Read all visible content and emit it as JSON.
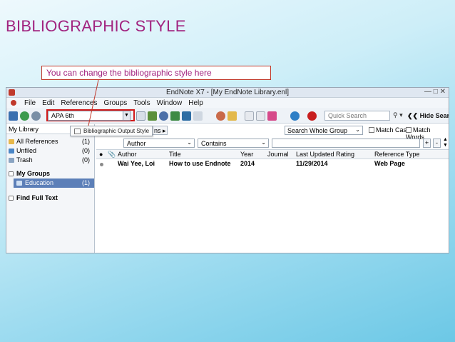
{
  "slide": {
    "title": "BIBLIOGRAPHIC STYLE",
    "callout": "You can change the bibliographic style here"
  },
  "window": {
    "title": "EndNote X7 - [My EndNote Library.enl]"
  },
  "menu": [
    "File",
    "Edit",
    "References",
    "Groups",
    "Tools",
    "Window",
    "Help"
  ],
  "toolbar": {
    "style_value": "APA 6th",
    "quick_search_placeholder": "Quick Search",
    "hide_search_label": "Hide Search Pa"
  },
  "tooltip": "Bibliographic Output Style",
  "sidebar": {
    "header": "My Library",
    "items": [
      {
        "label": "All References",
        "count": "(1)"
      },
      {
        "label": "Unfiled",
        "count": "(0)"
      },
      {
        "label": "Trash",
        "count": "(0)"
      }
    ],
    "groups_header": "My Groups",
    "group_items": [
      {
        "label": "Education",
        "count": "(1)"
      }
    ],
    "find_full_text": "Find Full Text"
  },
  "search_panel": {
    "options_label": "ns",
    "search_whole_group": "Search Whole Group",
    "match_case": "Match Case",
    "match_words": "Match Words",
    "field": "Author",
    "operator": "Contains"
  },
  "table": {
    "columns": [
      "Author",
      "Title",
      "Year",
      "Journal",
      "Last Updated",
      "Rating",
      "Reference Type"
    ],
    "rows": [
      {
        "author": "Wai Yee, Loi",
        "title": "How to use Endnote",
        "year": "2014",
        "journal": "",
        "last_updated": "11/29/2014",
        "rating": "",
        "reference_type": "Web Page"
      }
    ]
  },
  "colors": {
    "title": "#a1237f",
    "highlight_border": "#d11a1a",
    "selected_group": "#5c7fb8"
  }
}
